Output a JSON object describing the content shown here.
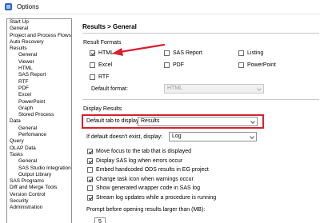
{
  "window": {
    "title": "Options",
    "icon": "options-window-icon"
  },
  "sidebar": {
    "items": [
      {
        "label": "Start Up",
        "level": 0
      },
      {
        "label": "General",
        "level": 0
      },
      {
        "label": "Project and Process Flows",
        "level": 0
      },
      {
        "label": "Auto Recovery",
        "level": 0
      },
      {
        "label": "Results",
        "level": 0
      },
      {
        "label": "General",
        "level": 1
      },
      {
        "label": "Viewer",
        "level": 1
      },
      {
        "label": "HTML",
        "level": 1
      },
      {
        "label": "SAS Report",
        "level": 1
      },
      {
        "label": "RTF",
        "level": 1
      },
      {
        "label": "PDF",
        "level": 1
      },
      {
        "label": "Excel",
        "level": 1
      },
      {
        "label": "PowerPoint",
        "level": 1
      },
      {
        "label": "Graph",
        "level": 1
      },
      {
        "label": "Stored Process",
        "level": 1
      },
      {
        "label": "Data",
        "level": 0
      },
      {
        "label": "General",
        "level": 1
      },
      {
        "label": "Perfomance",
        "level": 1
      },
      {
        "label": "Query",
        "level": 0
      },
      {
        "label": "OLAP Data",
        "level": 0
      },
      {
        "label": "Tasks",
        "level": 0
      },
      {
        "label": "General",
        "level": 1
      },
      {
        "label": "SAS Studio Integration",
        "level": 1
      },
      {
        "label": "Output Library",
        "level": 1
      },
      {
        "label": "SAS Programs",
        "level": 0
      },
      {
        "label": "Diff and Merge Tools",
        "level": 0
      },
      {
        "label": "Version Control",
        "level": 0
      },
      {
        "label": "Security",
        "level": 0
      },
      {
        "label": "Administration",
        "level": 0
      }
    ]
  },
  "main": {
    "title": "Results > General",
    "result_formats": {
      "label": "Result Formats",
      "options": [
        {
          "label": "HTML",
          "checked": true
        },
        {
          "label": "SAS Report",
          "checked": false
        },
        {
          "label": "Listing",
          "checked": false
        },
        {
          "label": "Excel",
          "checked": false
        },
        {
          "label": "PDF",
          "checked": false
        },
        {
          "label": "PowerPoint",
          "checked": false
        },
        {
          "label": "RTF",
          "checked": false
        }
      ],
      "default_format_label": "Default format:",
      "default_format_value": "HTML"
    },
    "display_results": {
      "label": "Display Results",
      "default_tab_label": "Default tab to display:",
      "default_tab_value": "Results",
      "if_not_exist_label": "If default doesn't exist, display:",
      "if_not_exist_value": "Log",
      "checkboxes": [
        {
          "label": "Move focus to the tab that is displayed",
          "checked": true
        },
        {
          "label": "Display SAS log when errors occur",
          "checked": true
        },
        {
          "label": "Embed handcoded ODS results in EG project",
          "checked": false
        },
        {
          "label": "Change task icon when warnings occur",
          "checked": true
        },
        {
          "label": "Show generated wrapper code in SAS log",
          "checked": false
        },
        {
          "label": "Stream log updates while a procedure is running",
          "checked": true
        }
      ],
      "prompt_label": "Prompt before opening results larger than (MB):",
      "prompt_value": "5"
    }
  },
  "annotations": {
    "highlight_color": "#d9202b",
    "arrow_color": "#d9202b"
  }
}
